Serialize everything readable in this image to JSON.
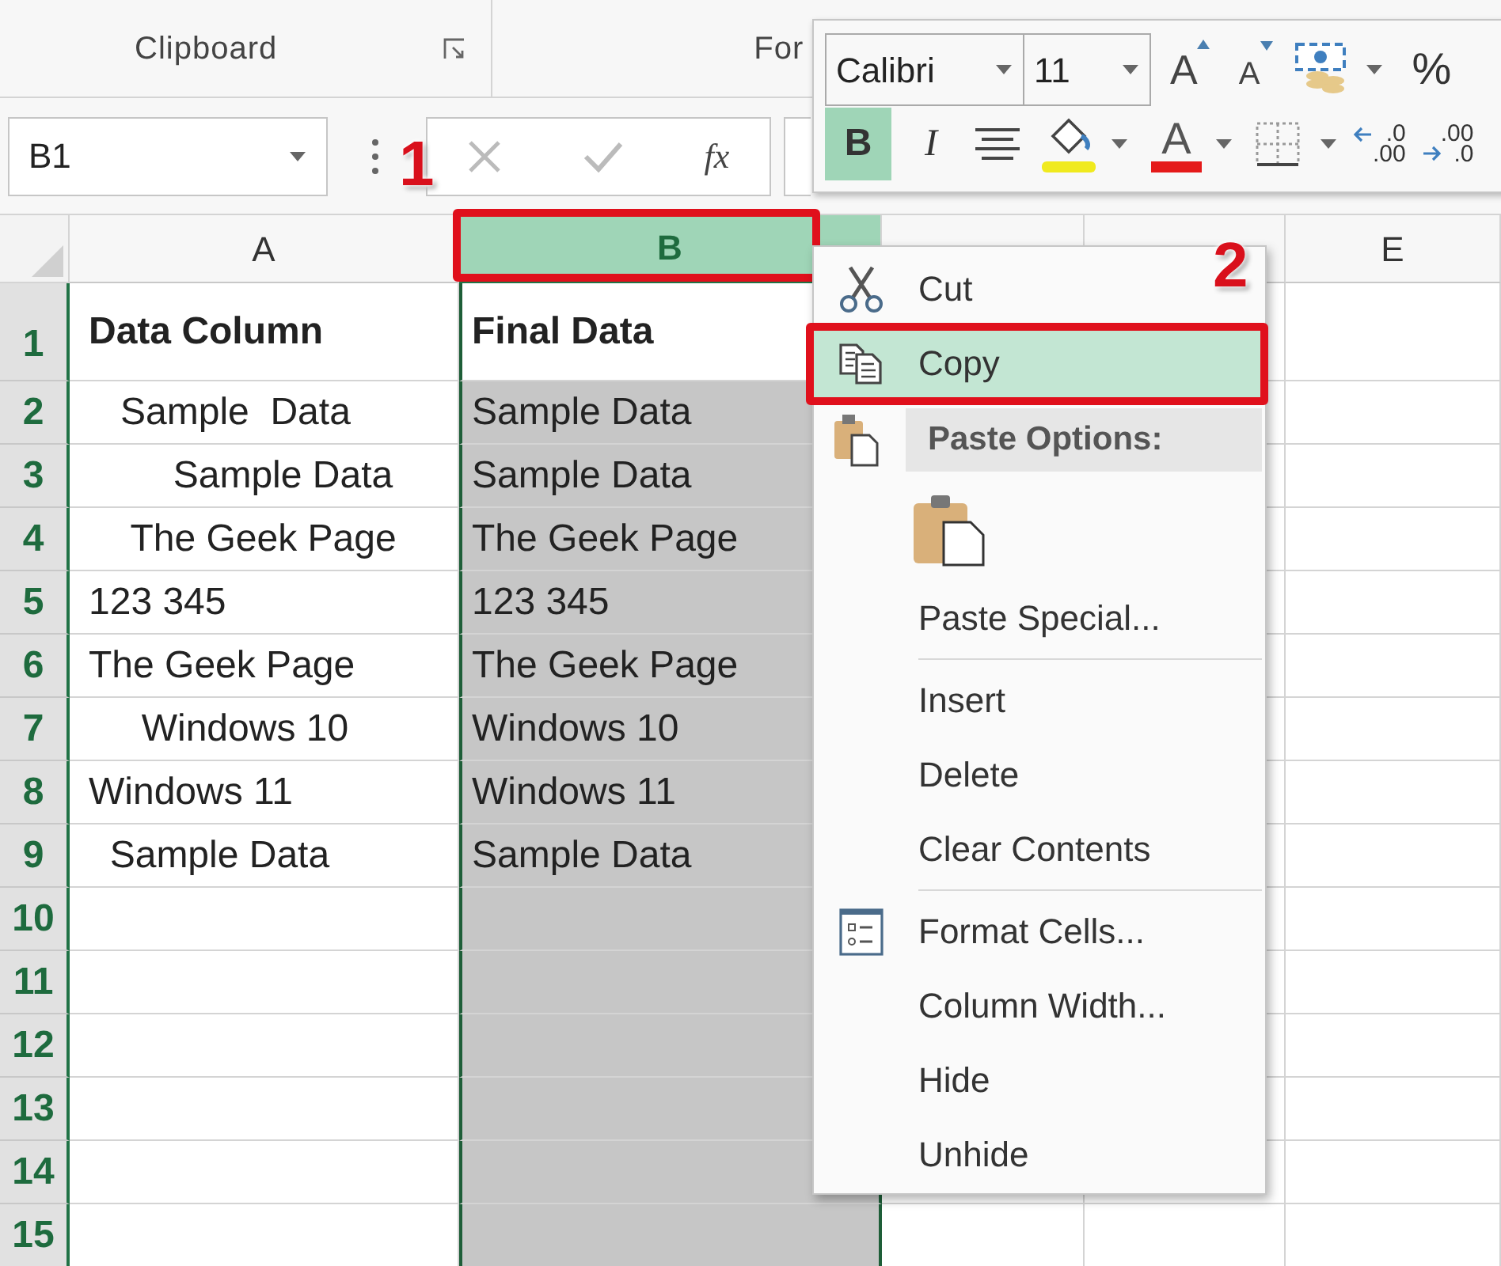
{
  "ribbon": {
    "group_label": "Clipboard",
    "next_group_label": "For"
  },
  "formula_bar": {
    "name_box": "B1",
    "function_label": "fx"
  },
  "columns": [
    {
      "label": "A",
      "selected": false
    },
    {
      "label": "B",
      "selected": true
    },
    {
      "selected": false
    },
    {
      "selected": false
    },
    {
      "label": "E",
      "selected": false
    }
  ],
  "rows": [
    {
      "number": "1",
      "bold": true,
      "cells": [
        "Data Column",
        "Final Data"
      ]
    },
    {
      "number": "2",
      "bold": false,
      "cells": [
        "   Sample  Data",
        "Sample Data"
      ]
    },
    {
      "number": "3",
      "bold": false,
      "cells": [
        "        Sample Data",
        "Sample Data"
      ]
    },
    {
      "number": "4",
      "bold": false,
      "cells": [
        "    The Geek Page",
        "The Geek Page"
      ]
    },
    {
      "number": "5",
      "bold": false,
      "cells": [
        "123 345",
        "123 345"
      ]
    },
    {
      "number": "6",
      "bold": false,
      "cells": [
        "The Geek Page",
        "The Geek Page"
      ]
    },
    {
      "number": "7",
      "bold": false,
      "cells": [
        "     Windows 10",
        "Windows 10"
      ]
    },
    {
      "number": "8",
      "bold": false,
      "cells": [
        "Windows 11",
        "Windows 11"
      ]
    },
    {
      "number": "9",
      "bold": false,
      "cells": [
        "  Sample Data",
        "Sample Data"
      ]
    },
    {
      "number": "10",
      "bold": false,
      "cells": [
        "",
        ""
      ]
    },
    {
      "number": "11",
      "bold": false,
      "cells": [
        "",
        ""
      ]
    },
    {
      "number": "12",
      "bold": false,
      "cells": [
        "",
        ""
      ]
    },
    {
      "number": "13",
      "bold": false,
      "cells": [
        "",
        ""
      ]
    },
    {
      "number": "14",
      "bold": false,
      "cells": [
        "",
        ""
      ]
    },
    {
      "number": "15",
      "bold": false,
      "cells": [
        "",
        ""
      ]
    }
  ],
  "mini_toolbar": {
    "font": "Calibri",
    "size": "11",
    "grow_font": "A",
    "shrink_font": "A",
    "percent": "%",
    "bold": {
      "label": "B",
      "selected": true
    },
    "italic": {
      "label": "I",
      "selected": false
    },
    "font_color": "A",
    "decimals": [
      {
        "top": ".0",
        "bottom": ".00"
      },
      {
        "top": ".00",
        "bottom": ".0"
      }
    ]
  },
  "context_menu": [
    {
      "kind": "command",
      "label": "Cut",
      "highlighted": false
    },
    {
      "kind": "command",
      "label": "Copy",
      "highlighted": true
    },
    {
      "kind": "section",
      "label": "Paste Options:"
    },
    {
      "kind": "paste_option"
    },
    {
      "kind": "command",
      "label": "Paste Special...",
      "highlighted": false
    },
    {
      "kind": "separator"
    },
    {
      "kind": "command",
      "label": "Insert",
      "highlighted": false
    },
    {
      "kind": "command",
      "label": "Delete",
      "highlighted": false
    },
    {
      "kind": "command",
      "label": "Clear Contents",
      "highlighted": false
    },
    {
      "kind": "separator"
    },
    {
      "kind": "command",
      "label": "Format Cells...",
      "highlighted": false
    },
    {
      "kind": "command",
      "label": "Column Width...",
      "highlighted": false
    },
    {
      "kind": "command",
      "label": "Hide",
      "highlighted": false
    },
    {
      "kind": "command",
      "label": "Unhide",
      "highlighted": false
    }
  ],
  "callouts": [
    "1",
    "2"
  ]
}
